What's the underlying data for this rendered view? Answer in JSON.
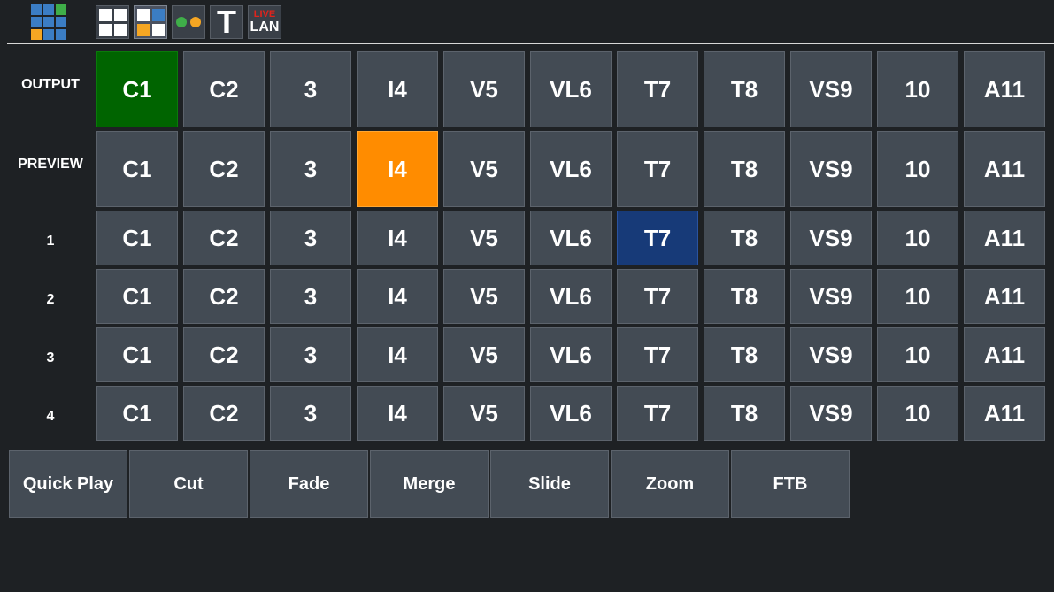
{
  "colors": {
    "background": "#1e2124",
    "tile": "#434b54",
    "program": "#006400",
    "preview": "#ff8c00",
    "selected": "#173a78",
    "logo_blue": "#3b7dc4",
    "logo_green": "#3fae49",
    "logo_orange": "#f5a623",
    "live_red": "#e0231c"
  },
  "toolbar": {
    "logo": "app-logo-grid-icon",
    "buttons": [
      {
        "name": "grid-view-icon",
        "active": false
      },
      {
        "name": "multiview-layout-icon",
        "active": true
      },
      {
        "name": "status-dots-icon",
        "active": false
      },
      {
        "name": "text-title-icon",
        "label": "T",
        "active": false
      },
      {
        "name": "live-lan-icon",
        "live": "LIVE",
        "lan": "LAN",
        "active": false
      }
    ]
  },
  "rows": [
    {
      "label": "OUTPUT",
      "state": "program",
      "active_index": 0
    },
    {
      "label": "PREVIEW",
      "state": "preview",
      "active_index": 3
    },
    {
      "label": "1",
      "state": "selected",
      "active_index": 6
    },
    {
      "label": "2",
      "state": "none",
      "active_index": -1
    },
    {
      "label": "3",
      "state": "none",
      "active_index": -1
    },
    {
      "label": "4",
      "state": "none",
      "active_index": -1
    }
  ],
  "sources": [
    "C1",
    "C2",
    "3",
    "I4",
    "V5",
    "VL6",
    "T7",
    "T8",
    "VS9",
    "10",
    "A11"
  ],
  "transitions": [
    "Quick Play",
    "Cut",
    "Fade",
    "Merge",
    "Slide",
    "Zoom",
    "FTB"
  ]
}
